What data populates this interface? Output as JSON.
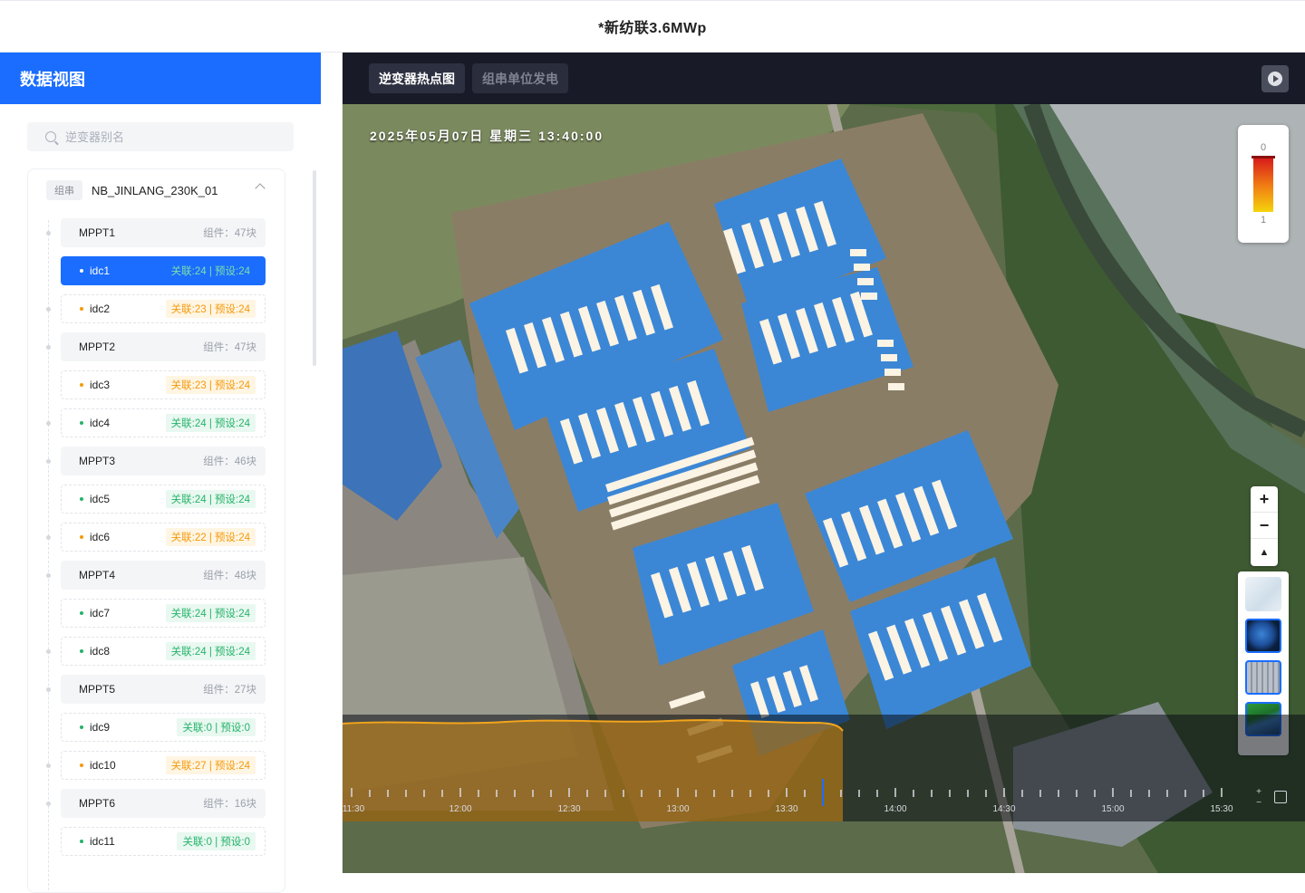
{
  "header": {
    "title": "*新纺联3.6MWp"
  },
  "sidebar": {
    "title": "数据视图",
    "search": {
      "placeholder": "逆变器别名",
      "value": ""
    },
    "group": {
      "tag": "组串",
      "name": "NB_JINLANG_230K_01"
    },
    "rows": [
      {
        "type": "mppt",
        "label": "MPPT1",
        "count": "组件：47块"
      },
      {
        "type": "idc",
        "label": "idc1",
        "badge": "关联:24 | 预设:24",
        "status": "green",
        "selected": true
      },
      {
        "type": "idc",
        "label": "idc2",
        "badge": "关联:23 | 预设:24",
        "status": "orange",
        "selected": false
      },
      {
        "type": "mppt",
        "label": "MPPT2",
        "count": "组件：47块"
      },
      {
        "type": "idc",
        "label": "idc3",
        "badge": "关联:23 | 预设:24",
        "status": "orange",
        "selected": false
      },
      {
        "type": "idc",
        "label": "idc4",
        "badge": "关联:24 | 预设:24",
        "status": "green",
        "selected": false
      },
      {
        "type": "mppt",
        "label": "MPPT3",
        "count": "组件：46块"
      },
      {
        "type": "idc",
        "label": "idc5",
        "badge": "关联:24 | 预设:24",
        "status": "green",
        "selected": false
      },
      {
        "type": "idc",
        "label": "idc6",
        "badge": "关联:22 | 预设:24",
        "status": "orange",
        "selected": false
      },
      {
        "type": "mppt",
        "label": "MPPT4",
        "count": "组件：48块"
      },
      {
        "type": "idc",
        "label": "idc7",
        "badge": "关联:24 | 预设:24",
        "status": "green",
        "selected": false
      },
      {
        "type": "idc",
        "label": "idc8",
        "badge": "关联:24 | 预设:24",
        "status": "green",
        "selected": false
      },
      {
        "type": "mppt",
        "label": "MPPT5",
        "count": "组件：27块"
      },
      {
        "type": "idc",
        "label": "idc9",
        "badge": "关联:0 | 预设:0",
        "status": "green",
        "selected": false
      },
      {
        "type": "idc",
        "label": "idc10",
        "badge": "关联:27 | 预设:24",
        "status": "orange",
        "selected": false
      },
      {
        "type": "mppt",
        "label": "MPPT6",
        "count": "组件：16块"
      },
      {
        "type": "idc",
        "label": "idc11",
        "badge": "关联:0 | 预设:0",
        "status": "green",
        "selected": false
      }
    ]
  },
  "map": {
    "tabs": [
      {
        "label": "逆变器热点图",
        "active": true
      },
      {
        "label": "组串单位发电",
        "active": false
      }
    ],
    "timestamp": "2025年05月07日 星期三 13:40:00",
    "legend": {
      "top": "0",
      "bottom": "1"
    },
    "zoom": {
      "in": "+",
      "out": "−",
      "compass": "▲"
    },
    "layers": [
      "map-layer",
      "globe-layer",
      "satellite-layer",
      "terrain-layer"
    ],
    "timeline": {
      "labels": [
        "11:30",
        "12:00",
        "12:30",
        "13:00",
        "13:30",
        "14:00",
        "14:30",
        "15:00",
        "15:30"
      ],
      "current": "13:40"
    },
    "colors": {
      "accent": "#1a6dff",
      "green": "#24b36b",
      "orange": "#f59a0b",
      "curve": "#f3a51c"
    }
  }
}
